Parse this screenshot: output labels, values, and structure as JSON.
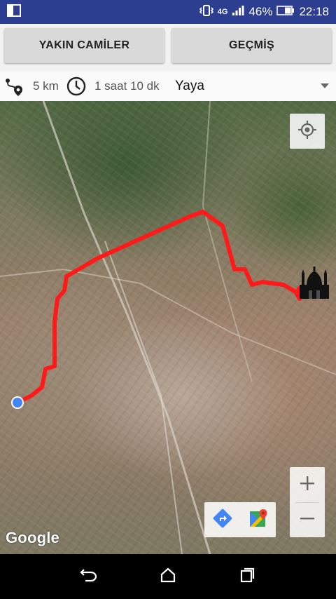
{
  "status_bar": {
    "network_type": "4G",
    "battery": "46%",
    "time": "22:18"
  },
  "actions": {
    "nearby_label": "YAKIN CAMİLER",
    "history_label": "GEÇMİŞ"
  },
  "route_info": {
    "distance": "5 km",
    "duration": "1 saat 10 dk",
    "mode": "Yaya"
  },
  "map": {
    "attribution": "Google",
    "route_color": "#ff1a1a",
    "origin_color": "#4285f4",
    "icons": [
      "my-location-icon",
      "zoom-in-icon",
      "zoom-out-icon",
      "directions-icon",
      "google-maps-icon",
      "mosque-icon",
      "location-pin-icon"
    ]
  },
  "nav": {
    "icons": [
      "back-icon",
      "home-icon",
      "recents-icon"
    ]
  }
}
